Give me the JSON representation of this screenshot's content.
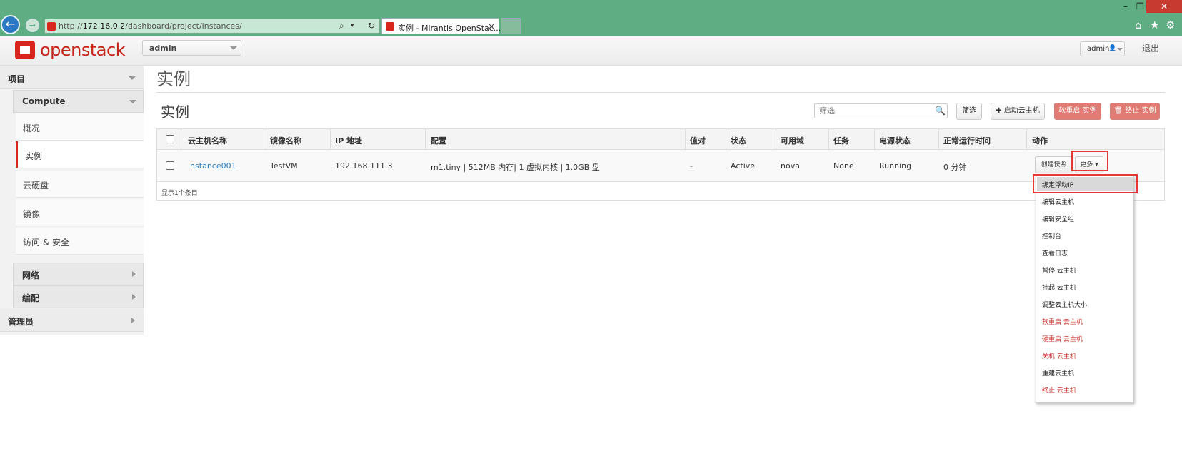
{
  "browser": {
    "url_prefix": "http://",
    "url_host": "172.16.0.2",
    "url_path": "/dashboard/project/instances/",
    "tab_title": "实例 - Mirantis OpenStac...",
    "tab_close": "×",
    "search_glyph": "⌕",
    "dropdown_glyph": "▾",
    "refresh_glyph": "↻",
    "back_glyph": "←",
    "fwd_glyph": "→",
    "min_glyph": "–",
    "restore_glyph": "❐",
    "close_glyph": "✕",
    "home_glyph": "⌂",
    "star_glyph": "★",
    "gear_glyph": "⚙"
  },
  "topbar": {
    "logo_text": "openstack",
    "project_select": "admin",
    "user_label": "admin",
    "user_glyph": "👤",
    "logout": "退出"
  },
  "sidebar": {
    "project_section": "项目",
    "compute": "Compute",
    "items": [
      {
        "label": "概况"
      },
      {
        "label": "实例"
      },
      {
        "label": "云硬盘"
      },
      {
        "label": "镜像"
      },
      {
        "label": "访问 & 安全"
      }
    ],
    "network": "网络",
    "orchestration": "编配",
    "admin_section": "管理员"
  },
  "main": {
    "page_title": "实例",
    "table_title": "实例",
    "filter_placeholder": "筛选",
    "search_glyph": "🔍",
    "filter_button": "筛选",
    "launch_button": "✚ 启动云主机",
    "soft_reboot_button": "软重启 实例",
    "terminate_button": "🗑 终止 实例",
    "columns": [
      "云主机名称",
      "镜像名称",
      "IP 地址",
      "配置",
      "值对",
      "状态",
      "可用域",
      "任务",
      "电源状态",
      "正常运行时间",
      "动作"
    ],
    "rows": [
      {
        "name": "instance001",
        "image": "TestVM",
        "ip": "192.168.111.3",
        "flavor": "m1.tiny | 512MB 内存| 1 虚拟内核 | 1.0GB 盘",
        "keypair": "-",
        "status": "Active",
        "zone": "nova",
        "task": "None",
        "power": "Running",
        "uptime": "0 分钟",
        "action_snapshot": "创建快照",
        "action_more": "更多 ▾"
      }
    ],
    "footer": "显示1个条目"
  },
  "more_menu": {
    "items": [
      {
        "label": "绑定浮动IP",
        "danger": false
      },
      {
        "label": "编辑云主机",
        "danger": false
      },
      {
        "label": "编辑安全组",
        "danger": false
      },
      {
        "label": "控制台",
        "danger": false
      },
      {
        "label": "查看日志",
        "danger": false
      },
      {
        "label": "暂停 云主机",
        "danger": false
      },
      {
        "label": "挂起 云主机",
        "danger": false
      },
      {
        "label": "调整云主机大小",
        "danger": false
      },
      {
        "label": "软重启 云主机",
        "danger": true
      },
      {
        "label": "硬重启 云主机",
        "danger": true
      },
      {
        "label": "关机 云主机",
        "danger": true
      },
      {
        "label": "重建云主机",
        "danger": false
      },
      {
        "label": "终止 云主机",
        "danger": true
      }
    ]
  },
  "colors": {
    "browser_chrome": "#5fad82",
    "brand_red": "#d9261c",
    "link_blue": "#2a7dc0",
    "danger_button": "#e07a72",
    "highlight_red": "#e53935"
  }
}
